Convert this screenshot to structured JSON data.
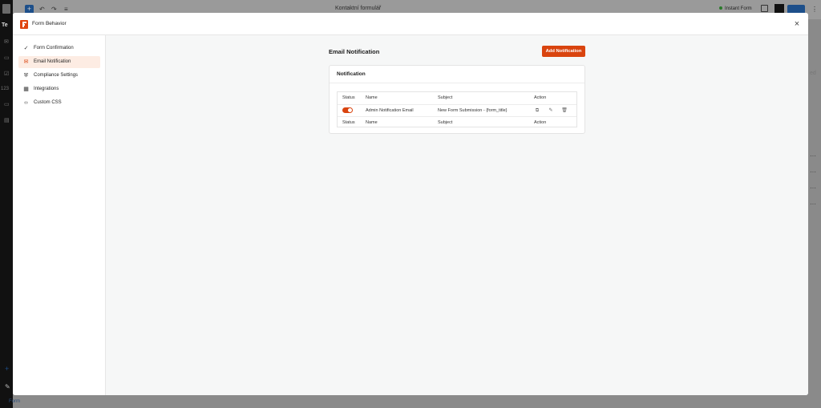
{
  "editor": {
    "document_title": "Kontaktní formulář",
    "instant_form_label": "Instant Form",
    "left_text_1": "Te",
    "left_text_2": "123",
    "bottom_tab": "Form",
    "right_fragment": "ed"
  },
  "modal": {
    "title": "Form Behavior",
    "close_symbol": "×"
  },
  "sidebar": {
    "items": [
      {
        "label": "Form Confirmation",
        "icon": "check-circle-icon",
        "glyph": "✓"
      },
      {
        "label": "Email Notification",
        "icon": "envelope-icon",
        "glyph": "✉"
      },
      {
        "label": "Compliance Settings",
        "icon": "shield-icon",
        "glyph": "⛨"
      },
      {
        "label": "Integrations",
        "icon": "grid-icon",
        "glyph": "▦"
      },
      {
        "label": "Custom CSS",
        "icon": "code-icon",
        "glyph": "‹›"
      }
    ],
    "active_index": 1
  },
  "main": {
    "section_title": "Email Notification",
    "add_button_label": "Add Notification",
    "card_title": "Notification",
    "table": {
      "headers": [
        "Status",
        "Name",
        "Subject",
        "Action"
      ],
      "rows": [
        {
          "status_on": true,
          "name": "Admin Notification Email",
          "subject": "New Form Submission - {form_title}"
        }
      ],
      "footer_headers": [
        "Status",
        "Name",
        "Subject",
        "Action"
      ]
    },
    "action_icons": [
      "duplicate-icon",
      "edit-icon",
      "trash-icon"
    ]
  },
  "colors": {
    "accent": "#d9440f",
    "active_bg": "#fdece3",
    "content_bg": "#f6f7f7"
  }
}
